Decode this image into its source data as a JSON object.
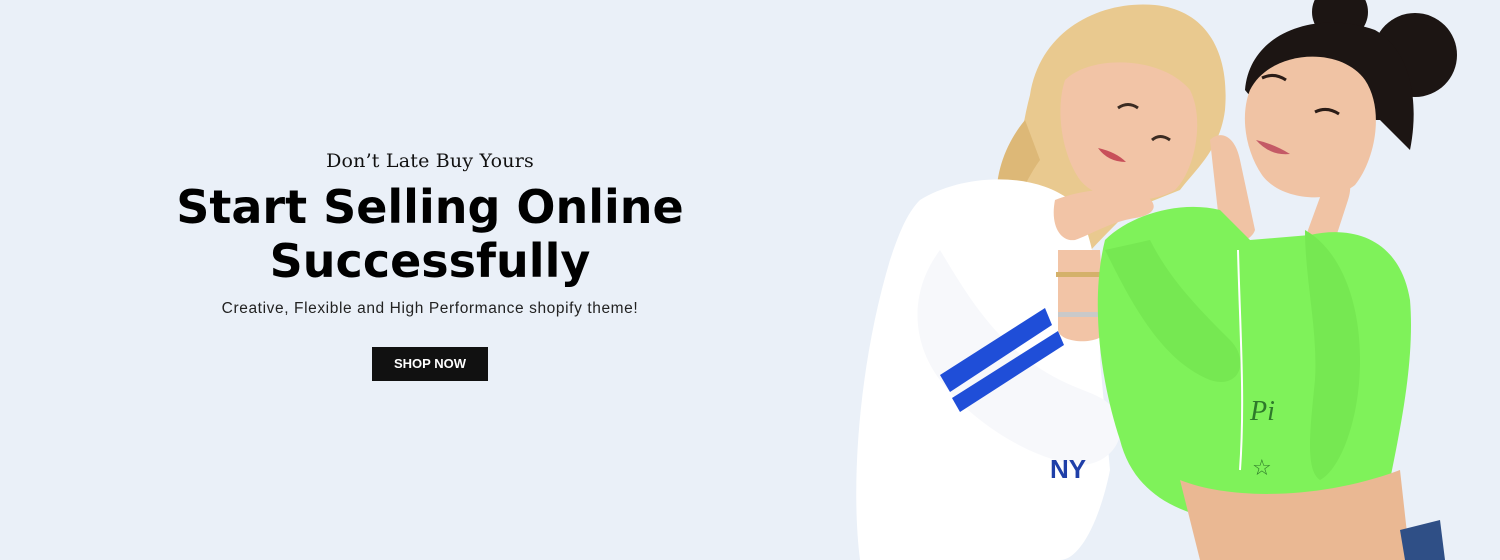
{
  "hero": {
    "tagline": "Don’t Late Buy Yours",
    "headline_line1": "Start Selling Online",
    "headline_line2": "Successfully",
    "subtitle": "Creative, Flexible and High Performance shopify theme!",
    "cta_label": "SHOP NOW"
  },
  "colors": {
    "background": "#eaf0f8",
    "button": "#111111",
    "button_text": "#ffffff",
    "hoodie_green": "#7ff25a",
    "sweater_white": "#ffffff",
    "stripe_blue": "#1f4ed8"
  },
  "image": {
    "subject": "two-models-photo"
  }
}
